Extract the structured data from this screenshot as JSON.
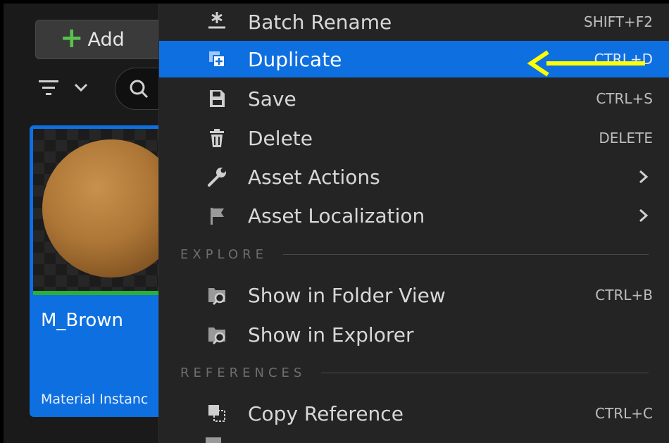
{
  "toolbar": {
    "add_label": "Add"
  },
  "asset": {
    "name": "M_Brown",
    "type": "Material Instanc"
  },
  "menu": {
    "items": [
      {
        "label": "Batch Rename",
        "shortcut": "SHIFT+F2",
        "icon": "batch-rename-icon"
      },
      {
        "label": "Duplicate",
        "shortcut": "CTRL+D",
        "icon": "duplicate-icon",
        "selected": true
      },
      {
        "label": "Save",
        "shortcut": "CTRL+S",
        "icon": "save-icon"
      },
      {
        "label": "Delete",
        "shortcut": "DELETE",
        "icon": "trash-icon"
      },
      {
        "label": "Asset Actions",
        "shortcut": "",
        "icon": "wrench-icon",
        "submenu": true
      },
      {
        "label": "Asset Localization",
        "shortcut": "",
        "icon": "flag-icon",
        "submenu": true
      },
      {
        "label": "Show in Folder View",
        "shortcut": "CTRL+B",
        "icon": "folder-search-icon"
      },
      {
        "label": "Show in Explorer",
        "shortcut": "",
        "icon": "folder-search-icon"
      },
      {
        "label": "Copy Reference",
        "shortcut": "CTRL+C",
        "icon": "copy-reference-icon"
      }
    ],
    "sections": {
      "explore": "EXPLORE",
      "references": "REFERENCES"
    }
  },
  "colors": {
    "accent": "#0e6fe0",
    "annotation_arrow": "#ffff00",
    "add_plus": "#58c24c"
  }
}
